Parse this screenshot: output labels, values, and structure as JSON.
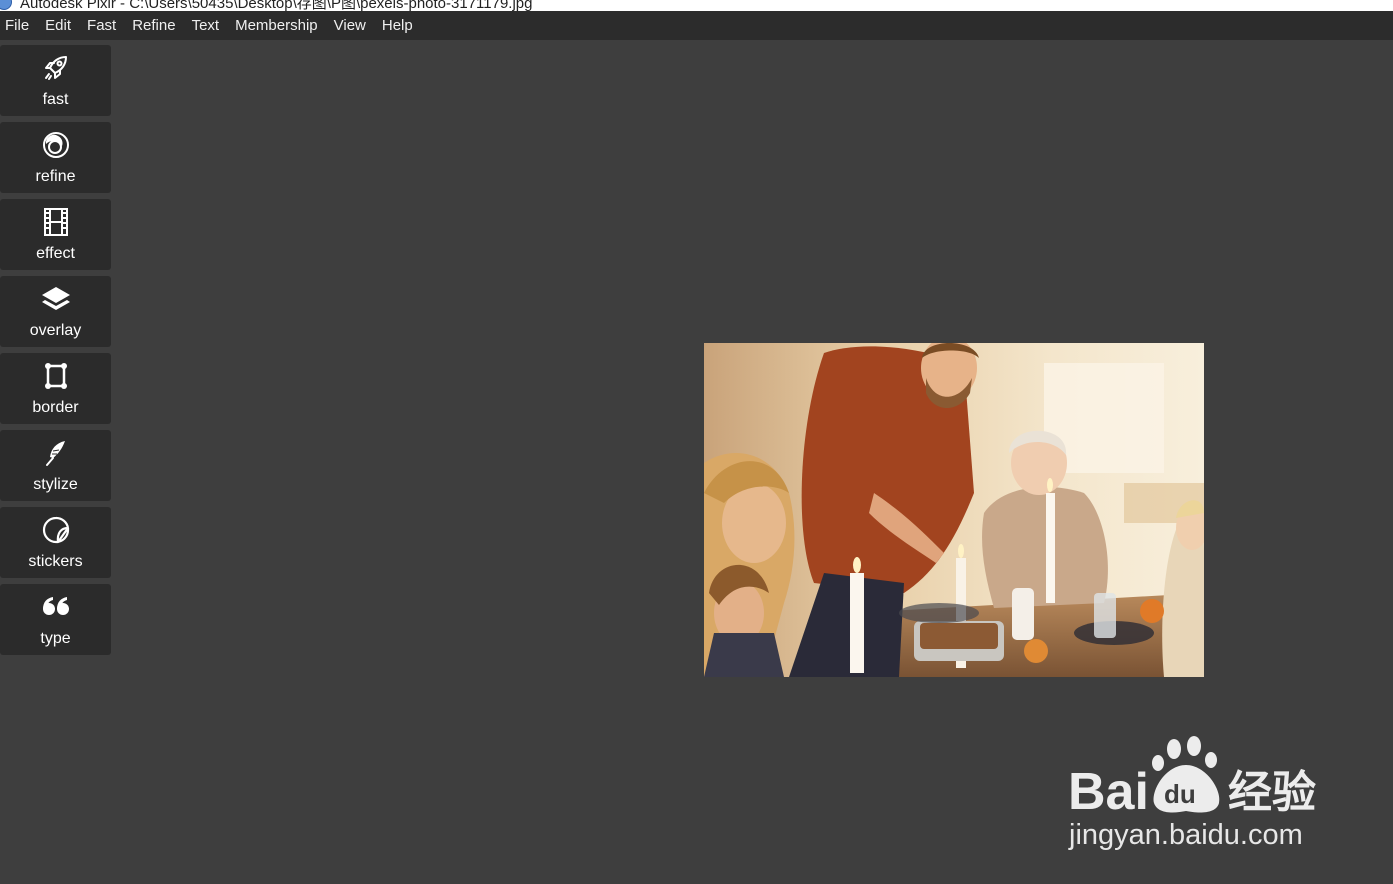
{
  "window": {
    "title": "Autodesk Pixlr - C:\\Users\\50435\\Desktop\\存图\\P图\\pexels-photo-3171179.jpg"
  },
  "menu": [
    {
      "label": "File"
    },
    {
      "label": "Edit"
    },
    {
      "label": "Fast"
    },
    {
      "label": "Refine"
    },
    {
      "label": "Text"
    },
    {
      "label": "Membership"
    },
    {
      "label": "View"
    },
    {
      "label": "Help"
    }
  ],
  "tools": [
    {
      "label": "fast",
      "icon": "rocket-icon"
    },
    {
      "label": "refine",
      "icon": "refine-circles-icon"
    },
    {
      "label": "effect",
      "icon": "film-strip-icon"
    },
    {
      "label": "overlay",
      "icon": "layers-icon"
    },
    {
      "label": "border",
      "icon": "border-frame-icon"
    },
    {
      "label": "stylize",
      "icon": "feather-icon"
    },
    {
      "label": "stickers",
      "icon": "sticker-icon"
    },
    {
      "label": "type",
      "icon": "quote-icon"
    }
  ],
  "canvas": {
    "image_description": "family dinner photo"
  },
  "watermark": {
    "brand": "Bai du 经验",
    "url": "jingyan.baidu.com"
  },
  "colors": {
    "background": "#3e3e3e",
    "menubar": "#2c2c2c",
    "tool_button": "#2b2b2b",
    "text": "#ffffff"
  }
}
